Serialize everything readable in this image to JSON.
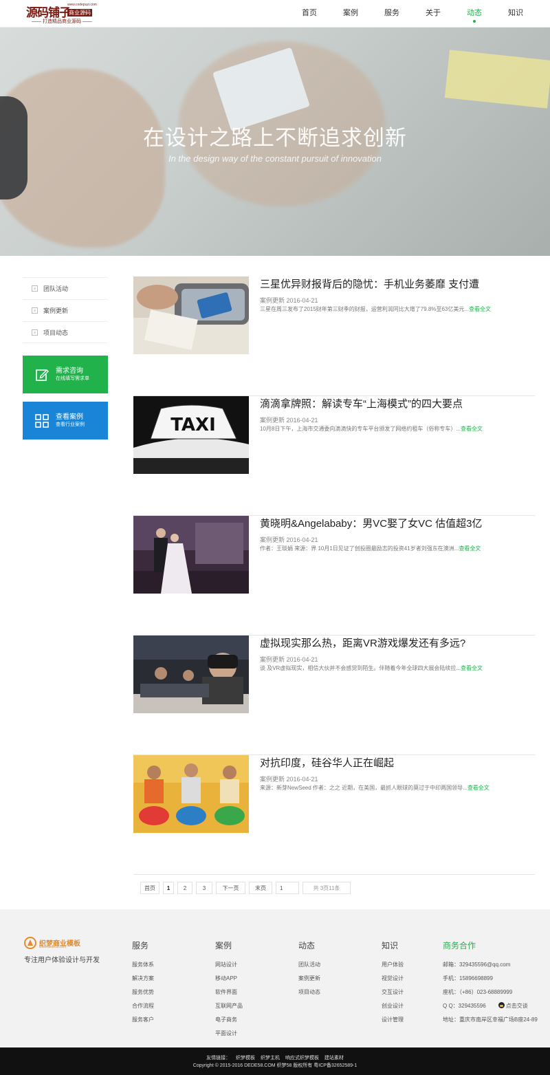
{
  "header": {
    "logo_main": "源码铺子",
    "logo_badge": "商业源码",
    "logo_url": "www.codepuzi.com",
    "logo_sub": "—— 打造精品商业源码 ——",
    "nav": [
      "首页",
      "案例",
      "服务",
      "关于",
      "动态",
      "知识"
    ],
    "nav_active": "动态"
  },
  "banner": {
    "title": "在设计之路上不断追求创新",
    "subtitle": "In the design way of the constant pursuit of innovation"
  },
  "sidebar": {
    "categories": [
      "团队活动",
      "案例更新",
      "项目动态"
    ],
    "buttons": [
      {
        "title": "需求咨询",
        "sub": "在线填写需求单"
      },
      {
        "title": "查看案例",
        "sub": "查看行业案例"
      }
    ]
  },
  "articles": [
    {
      "title": "三星优异财报背后的隐忧：手机业务萎靡 支付遭",
      "meta": "案例更新 2016-04-21",
      "summary": "三星在周三发布了2015财年第三财季的财报，运营利润同比大增了79.8%至63亿美元...",
      "more": "查看全文"
    },
    {
      "title": "滴滴拿牌照：解读专车“上海模式”的四大要点",
      "meta": "案例更新 2016-04-21",
      "summary": "10月8日下午，上海市交通委向滴滴快的专车平台颁发了网络约租车（俗称专车）...",
      "more": "查看全文"
    },
    {
      "title": "黄晓明&Angelababy：男VC娶了女VC 估值超3亿",
      "meta": "案例更新 2016-04-21",
      "summary": "作者：王琰娟 来源：界 10月1日见证了创投圈最励志的投资41岁者刘强东在澳洲...",
      "more": "查看全文"
    },
    {
      "title": "虚拟现实那么热，距离VR游戏爆发还有多远?",
      "meta": "案例更新 2016-04-21",
      "summary": "谈 及VR虚拟现实，相信大伙并不会感觉到陌生。伴随着今年全球四大展会陆续拉...",
      "more": "查看全文"
    },
    {
      "title": "对抗印度，硅谷华人正在崛起",
      "meta": "案例更新 2016-04-21",
      "summary": "来源：新芽NewSeed 作者：之之 近期，在美国，最抓人眼球的莫过于中印两国领导...",
      "more": "查看全文"
    }
  ],
  "pager": {
    "first": "首页",
    "pages": [
      "1",
      "2",
      "3"
    ],
    "next": "下一页",
    "last": "末页",
    "input_value": "1",
    "total": "共 3页11条"
  },
  "footer": {
    "logo_name": "织梦商业模板",
    "logo_url": "www.dede58.com",
    "slogan": "专注用户体验设计与开发",
    "columns": [
      {
        "title": "服务",
        "links": [
          "服务体系",
          "解决方案",
          "服务优势",
          "合作流程",
          "服务客户"
        ]
      },
      {
        "title": "案例",
        "links": [
          "网站设计",
          "移动APP",
          "软件界面",
          "互联网产品",
          "电子商务",
          "平面设计"
        ]
      },
      {
        "title": "动态",
        "links": [
          "团队活动",
          "案例更新",
          "项目动态"
        ]
      },
      {
        "title": "知识",
        "links": [
          "用户体验",
          "视觉设计",
          "交互设计",
          "创业设计",
          "设计管理"
        ]
      }
    ],
    "contact": {
      "title": "商务合作",
      "email": "邮箱：329435596@qq.com",
      "phone": "手机：15896698899",
      "tel": "座机：（+86）023-68889999",
      "qq": "Q Q：329435596",
      "qq_link": "点击交谈",
      "address": "地址：重庆市南岸区幸福广场B座24-89"
    },
    "friend_label": "友情链接：",
    "friend_links": [
      "织梦模板",
      "织梦主机",
      "响应式织梦模板",
      "建站素材"
    ],
    "copyright": "Copyright © 2015-2016 DEDE58.COM 织梦58 版权所有 粤ICP备32652589-1"
  },
  "colors": {
    "accent": "#22b24c",
    "blue": "#1a85d6",
    "brand": "#7a1a10"
  }
}
